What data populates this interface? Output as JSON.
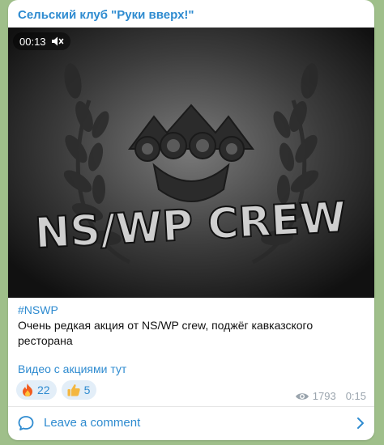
{
  "channel": {
    "name": "Сельский клуб \"Руки вверх!\""
  },
  "video": {
    "duration": "00:13",
    "muted_icon": "muted-speaker-icon",
    "artwork": {
      "logo_text": "NS/WP CREW",
      "motif": "brass-knuckles-with-laurel-wreath"
    }
  },
  "post": {
    "hashtag": "#NSWP",
    "text": "Очень редкая акция от NS/WP crew, поджёг кавказского ресторана",
    "link_text": "Видео с акциями тут"
  },
  "reactions": [
    {
      "emoji_icon": "fire-icon",
      "count": "22"
    },
    {
      "emoji_icon": "thumbs-up-icon",
      "count": "5"
    }
  ],
  "meta": {
    "views": "1793",
    "time": "0:15"
  },
  "comments": {
    "label": "Leave a comment"
  },
  "colors": {
    "accent": "#2e8bd0",
    "reaction_bg": "#e3eef8",
    "meta_gray": "#9aa4ad",
    "chat_bg": "#9fbf8a"
  }
}
